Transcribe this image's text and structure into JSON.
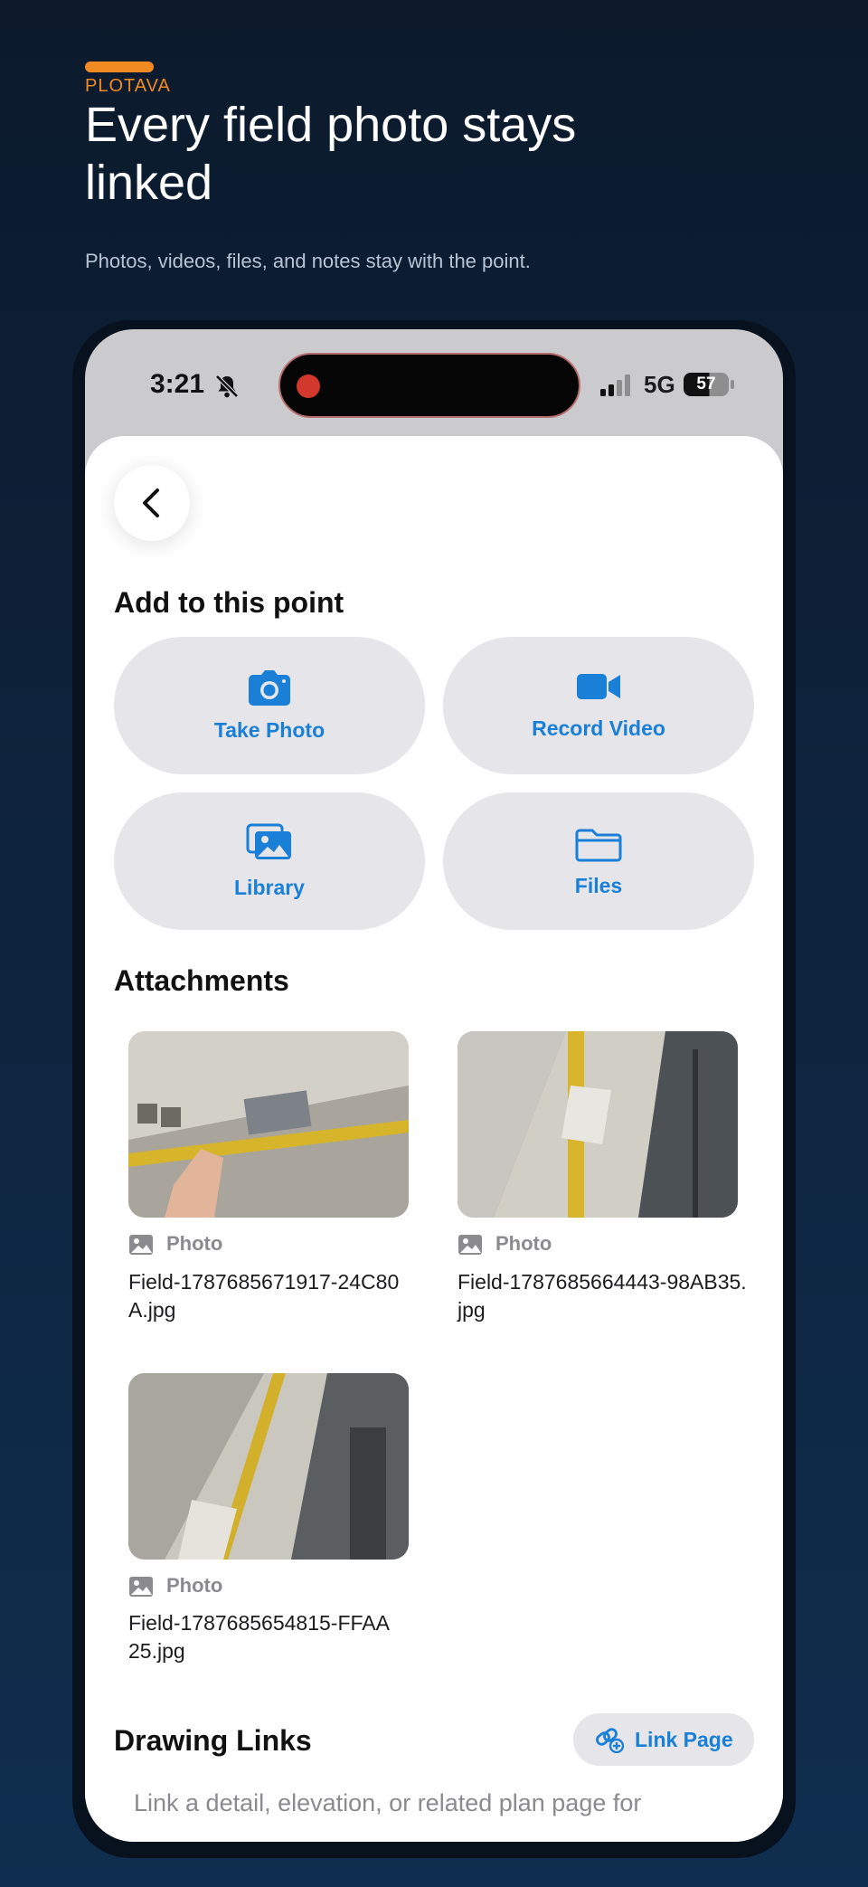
{
  "promo": {
    "brand": "PLOTAVA",
    "headline": "Every field photo stays linked",
    "subhead": "Photos, videos, files, and notes stay with the point."
  },
  "status_bar": {
    "time": "3:21",
    "network": "5G",
    "battery": "57"
  },
  "sheet": {
    "add_title": "Add to this point",
    "actions": [
      {
        "label": "Take Photo",
        "icon": "camera-icon"
      },
      {
        "label": "Record Video",
        "icon": "video-camera-icon"
      },
      {
        "label": "Library",
        "icon": "photo-library-icon"
      },
      {
        "label": "Files",
        "icon": "folder-icon"
      }
    ],
    "attachments_title": "Attachments",
    "attachments": [
      {
        "kind": "Photo",
        "filename": "Field-1787685671917-24C80A.jpg"
      },
      {
        "kind": "Photo",
        "filename": "Field-1787685664443-98AB35.jpg"
      },
      {
        "kind": "Photo",
        "filename": "Field-1787685654815-FFAA25.jpg"
      }
    ],
    "drawing_links_title": "Drawing Links",
    "link_page_label": "Link Page",
    "hint": "Link a detail, elevation, or related plan page for"
  },
  "colors": {
    "accent": "#1a7fd6",
    "brand": "#f28a24",
    "background": "#0e2540",
    "button_fill": "#e5e5ea"
  }
}
